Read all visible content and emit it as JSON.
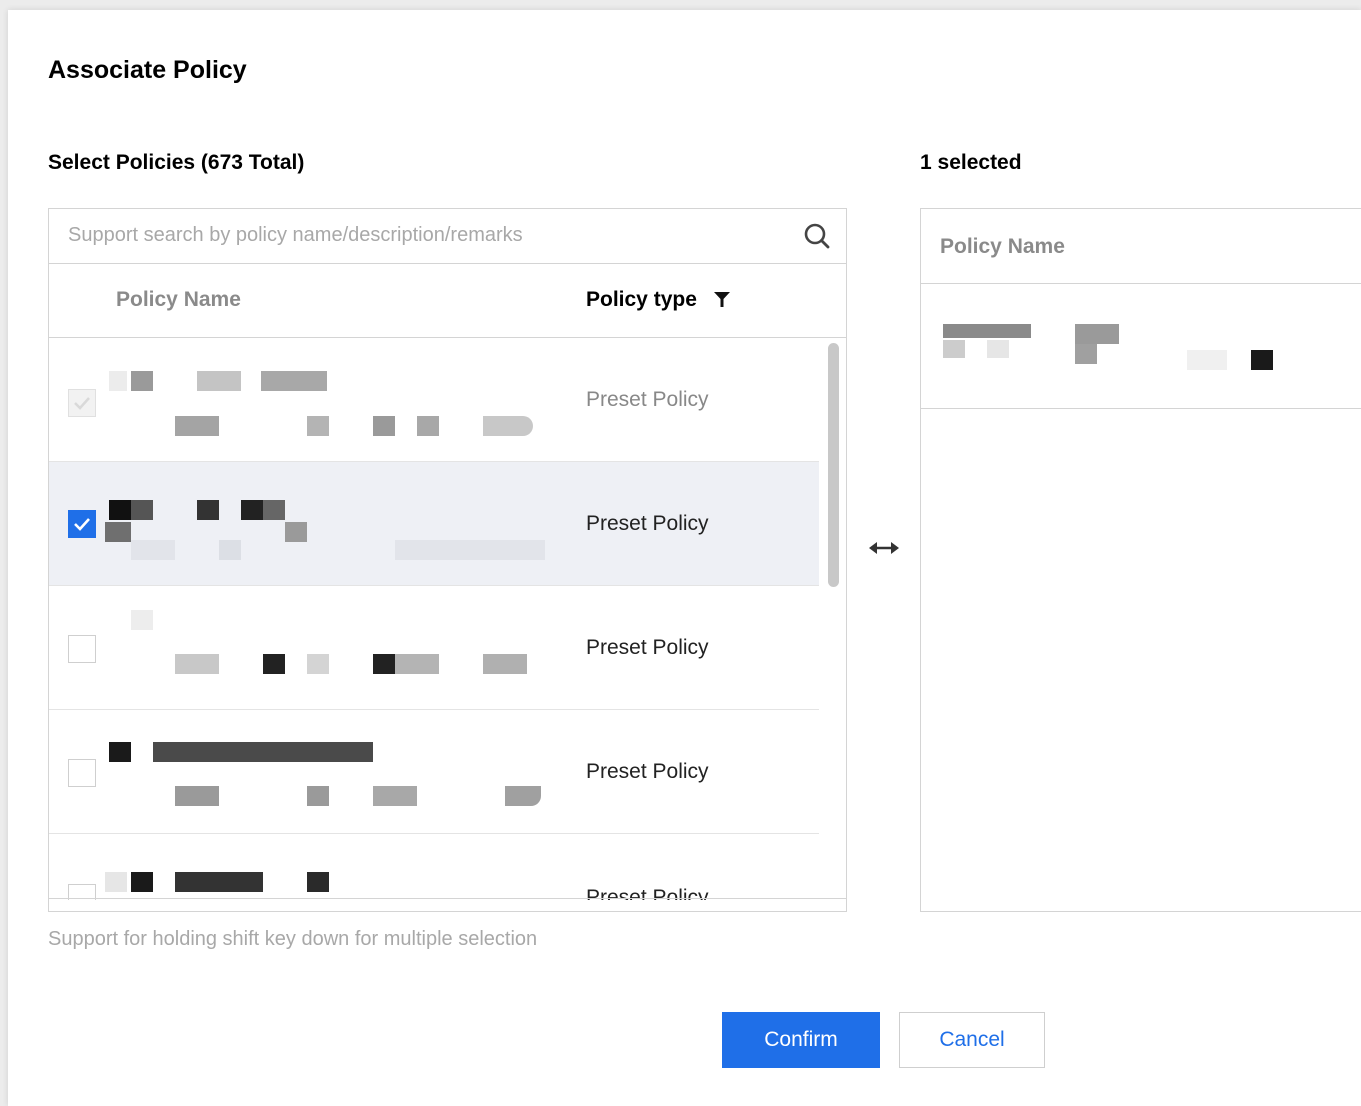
{
  "dialog": {
    "title": "Associate Policy",
    "left_heading": "Select Policies (673 Total)",
    "right_heading": "1 selected",
    "hint": "Support for holding shift key down for multiple selection"
  },
  "search": {
    "placeholder": "Support search by policy name/description/remarks",
    "icon": "search-icon"
  },
  "table": {
    "columns": {
      "name": "Policy Name",
      "type": "Policy type"
    },
    "filter_icon": "filter-icon",
    "rows": [
      {
        "type": "Preset Policy",
        "state": "disabled"
      },
      {
        "type": "Preset Policy",
        "state": "checked"
      },
      {
        "type": "Preset Policy",
        "state": "unchecked"
      },
      {
        "type": "Preset Policy",
        "state": "unchecked"
      },
      {
        "type": "Preset Policy",
        "state": "unchecked"
      }
    ]
  },
  "transfer_icon": "transfer-arrows-icon",
  "selected_panel": {
    "column": "Policy Name"
  },
  "buttons": {
    "confirm": "Confirm",
    "cancel": "Cancel"
  },
  "colors": {
    "primary": "#1f6fe8",
    "selected_row": "#eef0f5",
    "border": "#d4d4d4"
  }
}
